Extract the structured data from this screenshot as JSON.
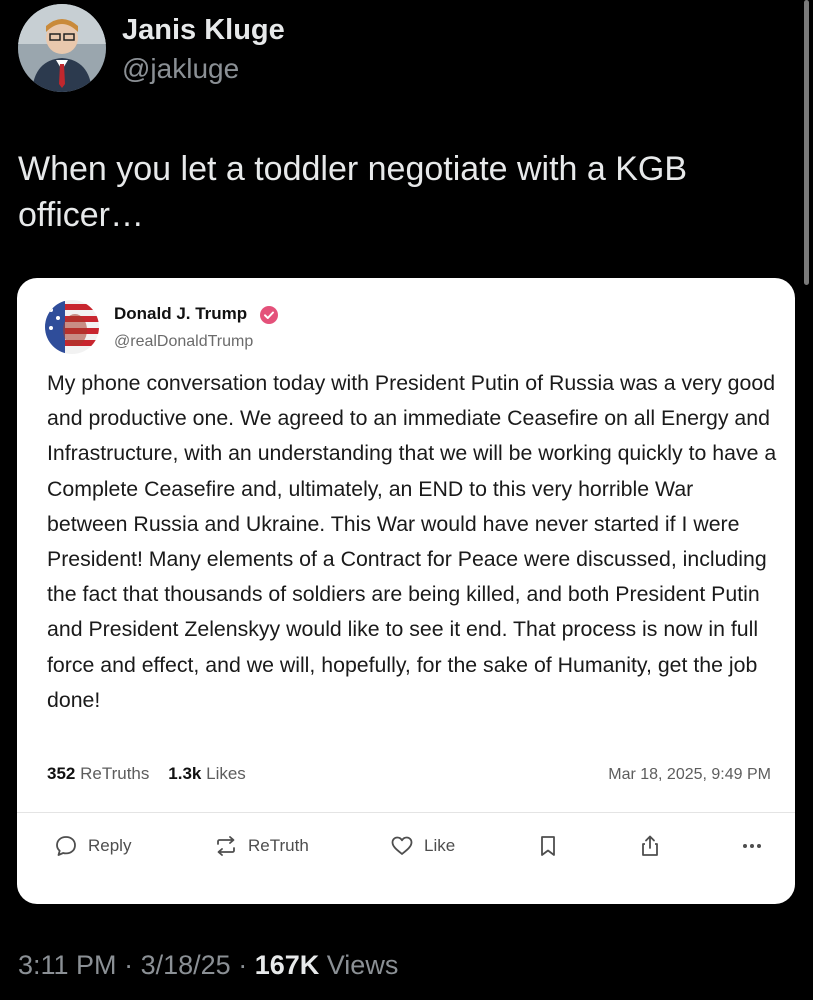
{
  "tweet": {
    "author_name": "Janis Kluge",
    "author_handle": "@jakluge",
    "text": "When you let a toddler negotiate with a KGB officer…",
    "time": "3:11 PM",
    "sep1": "·",
    "date": "3/18/25",
    "sep2": "·",
    "views_count": "167K",
    "views_label": "Views"
  },
  "quoted_post": {
    "author_name": "Donald J. Trump",
    "author_handle": "@realDonaldTrump",
    "body": "My phone conversation today with President Putin of Russia was a very good and productive one. We agreed to an immediate Ceasefire on all Energy and Infrastructure, with an understanding that we will be working quickly to have a Complete Ceasefire and, ultimately, an END to this very horrible War between Russia and Ukraine. This War would have never started if I were President! Many elements of a Contract for Peace were discussed, including the fact that thousands of soldiers are being killed, and both President Putin and President Zelenskyy would like to see it end. That process is now in full force and effect, and we will, hopefully, for the sake of Humanity, get the job done!",
    "retruths_count": "352",
    "retruths_label": "ReTruths",
    "likes_count": "1.3k",
    "likes_label": "Likes",
    "timestamp": "Mar 18, 2025, 9:49 PM",
    "actions": {
      "reply": "Reply",
      "retruth": "ReTruth",
      "like": "Like"
    },
    "verified_color": "#e4517a"
  }
}
